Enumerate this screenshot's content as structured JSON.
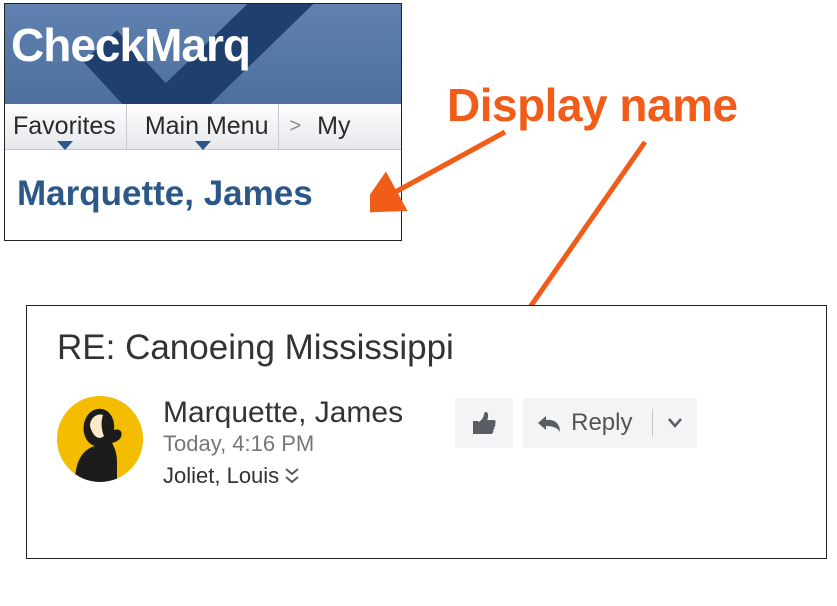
{
  "annotation": {
    "label": "Display name"
  },
  "checkmarq": {
    "title": "CheckMarq",
    "menu": {
      "favorites": "Favorites",
      "main_menu": "Main Menu",
      "my": "My"
    },
    "display_name": "Marquette, James"
  },
  "email": {
    "subject": "RE: Canoeing Mississippi",
    "sender": "Marquette, James",
    "timestamp": "Today, 4:16 PM",
    "recipient": "Joliet, Louis",
    "reply_label": "Reply"
  }
}
